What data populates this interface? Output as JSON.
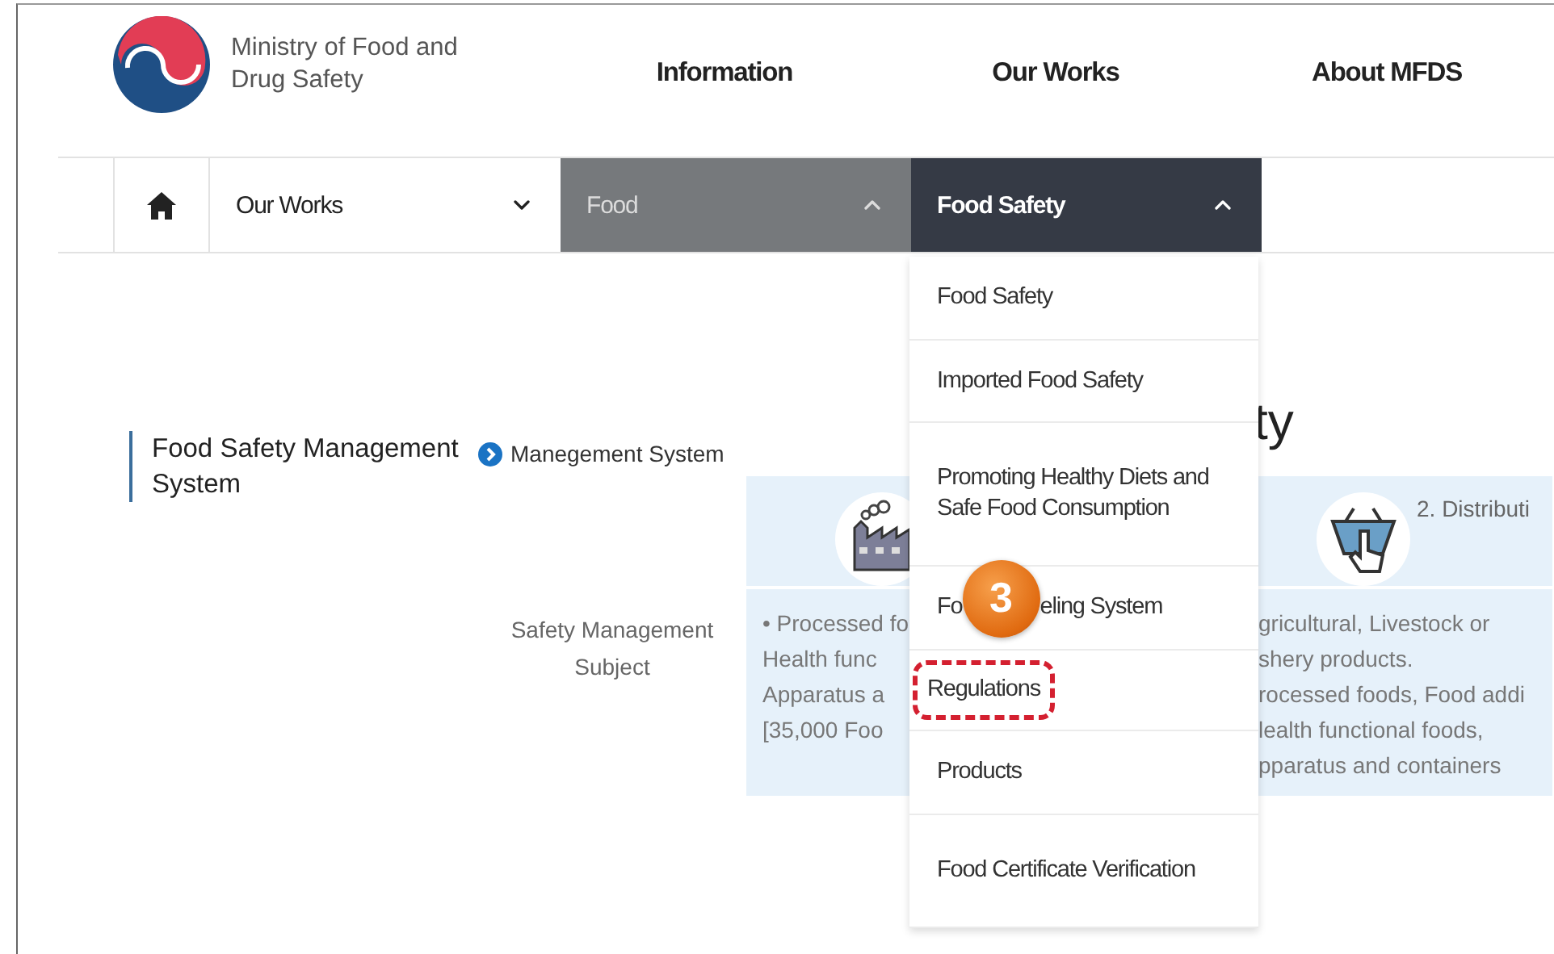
{
  "header": {
    "org_name": "Ministry of Food and Drug Safety",
    "nav": [
      "Information",
      "Our Works",
      "About MFDS"
    ]
  },
  "breadcrumb": [
    {
      "label": "Our Works",
      "kind": "plain",
      "expanded": false
    },
    {
      "label": "Food",
      "kind": "grey",
      "expanded": true
    },
    {
      "label": "Food Safety",
      "kind": "dark",
      "expanded": true
    }
  ],
  "page_title": "ty",
  "section": {
    "title": "Food Safety Management System",
    "subtitle": "Manegement System"
  },
  "table": {
    "row_label": "Safety Management Subject",
    "columns": [
      {
        "lines": [
          "• Processed fo",
          "Health func",
          "Apparatus a",
          "[35,000 Foo"
        ]
      },
      {
        "heading": "2. Distributi",
        "lines": [
          "gricultural, Livestock or",
          "shery products.",
          "rocessed foods, Food addi",
          "lealth functional foods,",
          "pparatus and containers"
        ]
      }
    ]
  },
  "dropdown": [
    {
      "parts": [
        "Food Safety"
      ],
      "highlighted": false
    },
    {
      "parts": [
        "Imported Food Safety"
      ],
      "highlighted": false
    },
    {
      "parts": [
        "Promoting Healthy Diets and Safe Food Consumption"
      ],
      "highlighted": false
    },
    {
      "parts": [
        "Fo",
        "eling System"
      ],
      "badge": "3",
      "highlighted": false
    },
    {
      "parts": [
        "Regulations"
      ],
      "highlighted": true
    },
    {
      "parts": [
        "Products"
      ],
      "highlighted": false
    },
    {
      "parts": [
        "Food Certificate Verification"
      ],
      "highlighted": false
    }
  ]
}
